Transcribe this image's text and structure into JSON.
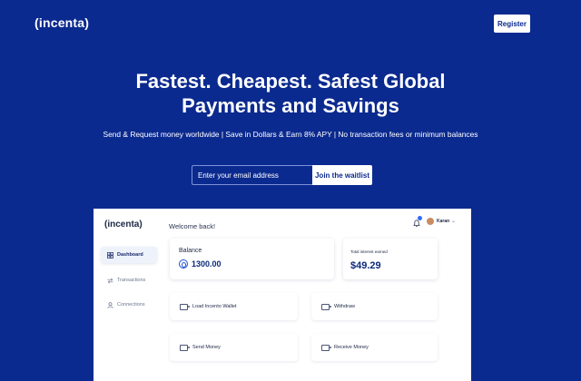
{
  "header": {
    "logo": "(incenta)",
    "register_label": "Register"
  },
  "hero": {
    "title_line1": "Fastest. Cheapest. Safest Global",
    "title_line2": "Payments and Savings",
    "subtitle": "Send & Request money worldwide | Save in Dollars & Earn 8% APY | No transaction fees or minimum balances",
    "email_placeholder": "Enter your email address",
    "join_label": "Join the waitlist"
  },
  "dashboard": {
    "logo": "(incenta)",
    "welcome": "Welcome back!",
    "user": {
      "name": "Karan"
    },
    "sidebar": {
      "items": [
        {
          "label": "Dashboard",
          "active": true,
          "icon": "dashboard-icon"
        },
        {
          "label": "Transactions",
          "active": false,
          "icon": "transactions-icon"
        },
        {
          "label": "Connections",
          "active": false,
          "icon": "user-icon"
        }
      ]
    },
    "balance": {
      "label": "Balance",
      "value": "1300.00"
    },
    "interest": {
      "label": "Total interest earned",
      "value": "$49.29"
    },
    "actions": [
      {
        "label": "Load Incento Wallet",
        "icon": "wallet-icon"
      },
      {
        "label": "Withdraw",
        "icon": "wallet-icon"
      },
      {
        "label": "Send Money",
        "icon": "wallet-icon"
      },
      {
        "label": "Receive Money",
        "icon": "wallet-icon"
      }
    ]
  },
  "colors": {
    "background": "#0b2a8f",
    "accent": "#1a4fd8",
    "text_dark": "#0d2a7a"
  }
}
